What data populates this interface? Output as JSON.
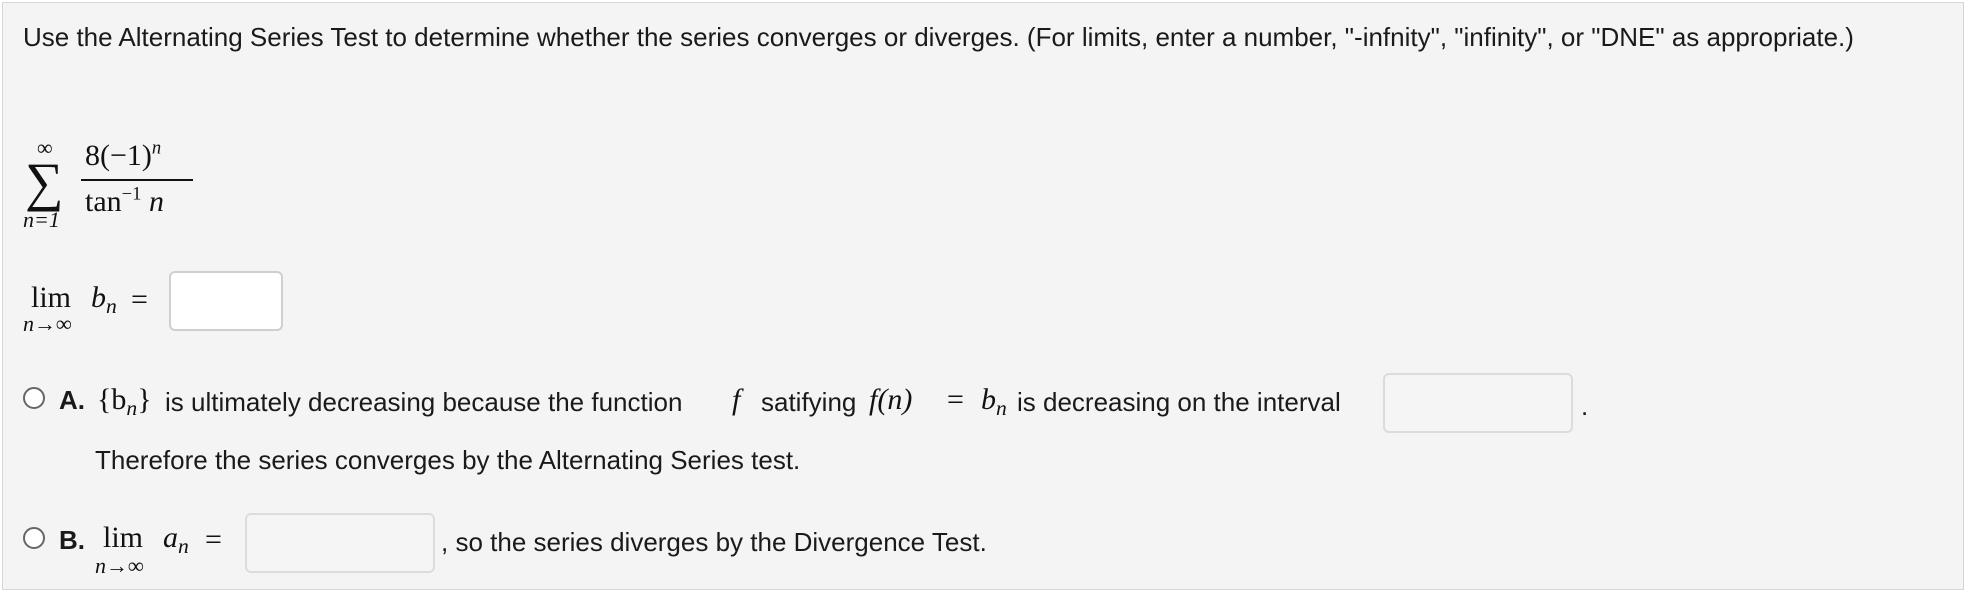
{
  "prompt": "Use the Alternating Series Test to determine whether the series converges or diverges. (For limits, enter a number, \"-infnity\", \"infinity\", or \"DNE\" as appropriate.)",
  "series": {
    "sum_symbol": "∑",
    "upper": "∞",
    "lower": "n=1",
    "numerator_coef": "8(−1)",
    "numerator_exp": "n",
    "denominator_fn": "tan",
    "denominator_exp": "−1",
    "denominator_var": "n"
  },
  "limit_b": {
    "lim": "lim",
    "sub": "n→∞",
    "var": "b",
    "var_sub": "n",
    "equals": "=",
    "value": ""
  },
  "option_a": {
    "letter": "A.",
    "seq_open": "{b",
    "seq_sub": "n",
    "seq_close": "}",
    "text1": "is ultimately decreasing because the function",
    "f": "f",
    "text2": "satifying",
    "f_of_n": "f(n)",
    "eq": "=",
    "bn": "b",
    "bn_sub": "n",
    "text3": "is decreasing on the interval",
    "interval_value": "",
    "period": ".",
    "line2": "Therefore the series converges by the Alternating Series test."
  },
  "option_b": {
    "letter": "B.",
    "lim": "lim",
    "sub": "n→∞",
    "var": "a",
    "var_sub": "n",
    "equals": "=",
    "value": "",
    "text": ", so the series diverges by the Divergence Test."
  }
}
